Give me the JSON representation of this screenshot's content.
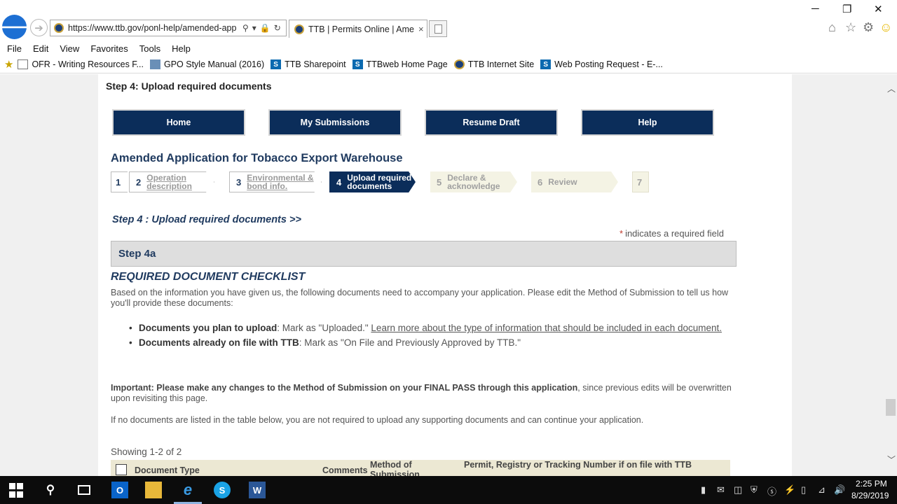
{
  "browser": {
    "url": "https://www.ttb.gov/ponl-help/amended-app",
    "tab_title": "TTB | Permits Online | Ame...",
    "tab_close": "×",
    "back_arrow": "🡐",
    "forward_arrow": "➔",
    "window_controls": {
      "minimize": "─",
      "maximize": "❐",
      "close": "✕"
    },
    "menu": [
      "File",
      "Edit",
      "View",
      "Favorites",
      "Tools",
      "Help"
    ],
    "favorites": [
      {
        "label": "OFR - Writing Resources F...",
        "icon": "document-icon"
      },
      {
        "label": "GPO Style Manual (2016)",
        "icon": "gpo-icon"
      },
      {
        "label": "TTB Sharepoint",
        "icon": "sharepoint-icon"
      },
      {
        "label": "TTBweb Home Page",
        "icon": "sharepoint-icon"
      },
      {
        "label": "TTB Internet Site",
        "icon": "ttb-seal-icon"
      },
      {
        "label": "Web Posting Request - E-...",
        "icon": "sharepoint-icon"
      }
    ]
  },
  "page": {
    "crumb_title": "Step 4: Upload required documents",
    "nav_buttons": [
      "Home",
      "My Submissions",
      "Resume Draft",
      "Help"
    ],
    "app_title": "Amended Application for Tobacco Export Warehouse",
    "steps": [
      {
        "num": "1",
        "label": ""
      },
      {
        "num": "2",
        "label": "Operation description"
      },
      {
        "num": "3",
        "label": "Environmental & bond info."
      },
      {
        "num": "4",
        "label": "Upload required documents"
      },
      {
        "num": "5",
        "label": "Declare & acknowledge"
      },
      {
        "num": "6",
        "label": "Review"
      },
      {
        "num": "7",
        "label": ""
      }
    ],
    "active_step": "4",
    "step_heading": "Step 4 : Upload required documents >>",
    "required_star": "*",
    "required_note": "indicates a required field",
    "section_title": "Step 4a",
    "checklist_title": "REQUIRED DOCUMENT CHECKLIST",
    "intro": "Based on the information you have given us, the following documents need to accompany your application. Please edit the Method of Submission to tell us how you'll provide these documents:",
    "bullet1_strong": "Documents you plan to upload",
    "bullet1_text": ": Mark as \"Uploaded.\" ",
    "bullet1_link": "Learn more about the type of information that should be included in each document.",
    "bullet2_strong": "Documents already on file with TTB",
    "bullet2_text": ": Mark as \"On File and Previously Approved by TTB.\"",
    "important_strong": "Important: Please make any changes to the Method of Submission on your FINAL PASS through this application",
    "important_text": ", since previous edits will be overwritten upon revisiting this page.",
    "no_docs": "If no documents are listed in the table below, you are not required to upload any supporting documents and can continue your application.",
    "showing": "Showing 1-2 of 2",
    "table_headers": {
      "doc_type": "Document Type",
      "comments": "Comments",
      "method": "Method of Submission",
      "permit": "Permit, Registry or Tracking Number if on file with TTB"
    }
  },
  "taskbar": {
    "time": "2:25 PM",
    "date": "8/29/2019",
    "apps": [
      "outlook-icon",
      "file-explorer-icon",
      "internet-explorer-icon",
      "skype-icon",
      "word-icon"
    ]
  },
  "colors": {
    "brand_navy": "#0b2d5a",
    "heading_blue": "#1f3a5f",
    "table_header_bg": "#ece8d3",
    "required_red": "#c0392b"
  }
}
